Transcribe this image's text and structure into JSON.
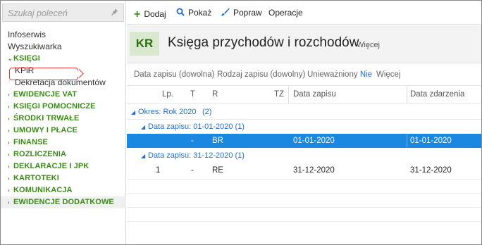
{
  "sidebar": {
    "search_placeholder": "Szukaj poleceń",
    "items": [
      {
        "label": "Infoserwis",
        "style": "plain"
      },
      {
        "label": "Wyszukiwarka",
        "style": "plain"
      },
      {
        "label": "KSIĘGI",
        "style": "group-open"
      },
      {
        "label": "KPiR",
        "style": "sub-selected"
      },
      {
        "label": "Dekretacja dokumentów",
        "style": "sub"
      },
      {
        "label": "EWIDENCJE VAT",
        "style": "group"
      },
      {
        "label": "KSIĘGI POMOCNICZE",
        "style": "group"
      },
      {
        "label": "ŚRODKI TRWAŁE",
        "style": "group"
      },
      {
        "label": "UMOWY I PŁACE",
        "style": "group"
      },
      {
        "label": "FINANSE",
        "style": "group"
      },
      {
        "label": "ROZLICZENIA",
        "style": "group"
      },
      {
        "label": "DEKLARACJE I JPK",
        "style": "group"
      },
      {
        "label": "KARTOTEKI",
        "style": "group"
      },
      {
        "label": "KOMUNIKACJA",
        "style": "group"
      },
      {
        "label": "EWIDENCJE DODATKOWE",
        "style": "group-hover"
      }
    ]
  },
  "toolbar": {
    "add_label": "Dodaj",
    "show_label": "Pokaż",
    "edit_label": "Popraw",
    "ops_label": "Operacje"
  },
  "header": {
    "badge": "KR",
    "title": "Księga przychodów i rozchodów",
    "more": "Więcej"
  },
  "filters": {
    "date": "Data zapisu (dowolna)",
    "type": "Rodzaj zapisu (dowolny)",
    "voided_label": "Unieważniony",
    "voided_value": "Nie",
    "more": "Więcej"
  },
  "grid": {
    "columns": [
      "Lp.",
      "T",
      "R",
      "TZ",
      "Data zapisu",
      "Data zdarzenia"
    ],
    "period_group": "Okres: Rok 2020",
    "period_count": "(2)",
    "groups": [
      {
        "label": "Data zapisu: 01-01-2020 (1)",
        "row": {
          "lp": "",
          "t": "-",
          "r": "BR",
          "tz": "",
          "date": "01-01-2020",
          "event_date": "01-01-2020"
        }
      },
      {
        "label": "Data zapisu: 31-12-2020 (1)",
        "row": {
          "lp": "1",
          "t": "-",
          "r": "RE",
          "tz": "",
          "date": "31-12-2020",
          "event_date": "31-12-2020"
        }
      }
    ]
  },
  "colors": {
    "accent_green": "#3a8c16",
    "selection_blue": "#1a88e0",
    "link_blue": "#1d6fd6",
    "highlight_red": "#e33a3a"
  }
}
